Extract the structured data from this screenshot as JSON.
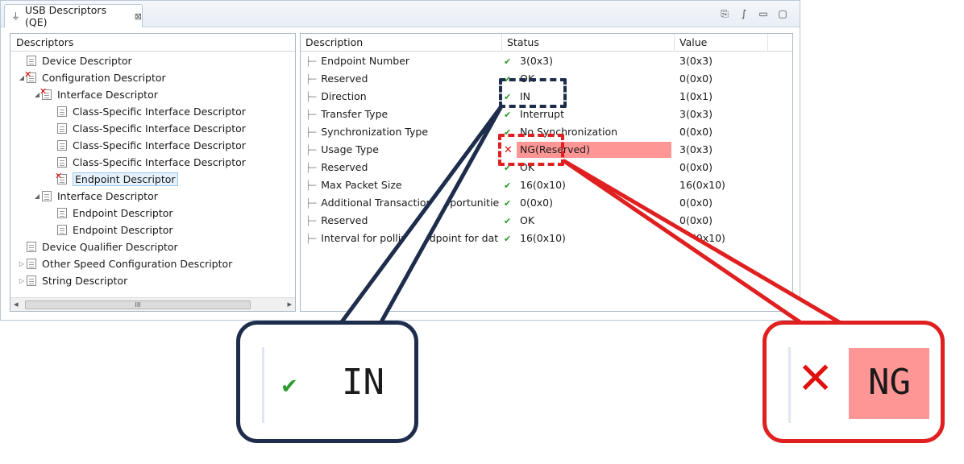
{
  "tab": {
    "title": "USB Descriptors (QE)",
    "close": "⊠"
  },
  "toolbar": [
    "⎘",
    "∫",
    "▭",
    "▢"
  ],
  "tree": {
    "header": "Descriptors",
    "items": [
      {
        "label": "Device Descriptor",
        "depth": 0,
        "twist": "",
        "error": false
      },
      {
        "label": "Configuration Descriptor",
        "depth": 0,
        "twist": "◢",
        "error": true
      },
      {
        "label": "Interface Descriptor",
        "depth": 1,
        "twist": "◢",
        "error": true
      },
      {
        "label": "Class-Specific Interface Descriptor",
        "depth": 2,
        "twist": "",
        "error": false
      },
      {
        "label": "Class-Specific Interface Descriptor",
        "depth": 2,
        "twist": "",
        "error": false
      },
      {
        "label": "Class-Specific Interface Descriptor",
        "depth": 2,
        "twist": "",
        "error": false
      },
      {
        "label": "Class-Specific Interface Descriptor",
        "depth": 2,
        "twist": "",
        "error": false
      },
      {
        "label": "Endpoint Descriptor",
        "depth": 2,
        "twist": "",
        "error": true,
        "selected": true
      },
      {
        "label": "Interface Descriptor",
        "depth": 1,
        "twist": "◢",
        "error": false
      },
      {
        "label": "Endpoint Descriptor",
        "depth": 2,
        "twist": "",
        "error": false
      },
      {
        "label": "Endpoint Descriptor",
        "depth": 2,
        "twist": "",
        "error": false
      },
      {
        "label": "Device Qualifier Descriptor",
        "depth": 0,
        "twist": "",
        "error": false
      },
      {
        "label": "Other Speed Configuration Descriptor",
        "depth": 0,
        "twist": "▷",
        "error": false
      },
      {
        "label": "String Descriptor",
        "depth": 0,
        "twist": "▷",
        "error": false
      }
    ],
    "scroll_left": "◂",
    "scroll_right": "▸",
    "thumb_grip": "III"
  },
  "table": {
    "headers": {
      "description": "Description",
      "status": "Status",
      "value": "Value"
    },
    "rows": [
      {
        "description": "Endpoint Number",
        "status": "3(0x3)",
        "value": "3(0x3)",
        "ok": true
      },
      {
        "description": "Reserved",
        "status": "OK",
        "value": "0(0x0)",
        "ok": true
      },
      {
        "description": "Direction",
        "status": "IN",
        "value": "1(0x1)",
        "ok": true
      },
      {
        "description": "Transfer Type",
        "status": "Interrupt",
        "value": "3(0x3)",
        "ok": true
      },
      {
        "description": "Synchronization Type",
        "status": "No Synchronization",
        "value": "0(0x0)",
        "ok": true
      },
      {
        "description": "Usage Type",
        "status": "NG(Reserved)",
        "value": "3(0x3)",
        "ok": false
      },
      {
        "description": "Reserved",
        "status": "OK",
        "value": "0(0x0)",
        "ok": true
      },
      {
        "description": "Max Packet Size",
        "status": "16(0x10)",
        "value": "16(0x10)",
        "ok": true
      },
      {
        "description": "Additional Transaction Opportunities...",
        "status": "0(0x0)",
        "value": "0(0x0)",
        "ok": true
      },
      {
        "description": "Reserved",
        "status": "OK",
        "value": "0(0x0)",
        "ok": true
      },
      {
        "description": "Interval for polling endpoint for data...",
        "status": "16(0x10)",
        "value": "16(0x10)",
        "ok": true
      }
    ]
  },
  "icons": {
    "ok": "✔",
    "ng": "✕",
    "branch": "├─"
  },
  "callouts": {
    "in_text": "IN",
    "ng_text": "NG"
  },
  "colors": {
    "navy": "#1f2d4d",
    "red": "#e02020",
    "ng_bg": "#ff9696",
    "ok_green": "#2a9a2a"
  }
}
